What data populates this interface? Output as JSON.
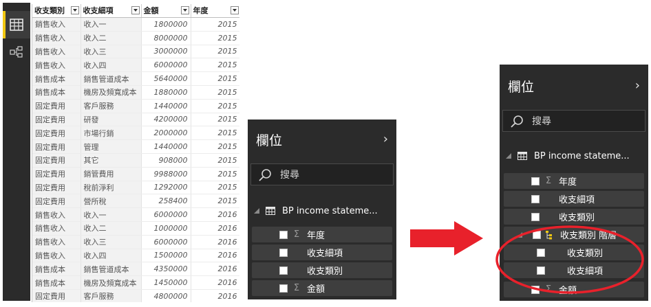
{
  "table": {
    "headers": [
      "收支類別",
      "收支細項",
      "金額",
      "年度"
    ],
    "rows": [
      [
        "銷售收入",
        "收入一",
        "1800000",
        "2015"
      ],
      [
        "銷售收入",
        "收入二",
        "8000000",
        "2015"
      ],
      [
        "銷售收入",
        "收入三",
        "3000000",
        "2015"
      ],
      [
        "銷售收入",
        "收入四",
        "6000000",
        "2015"
      ],
      [
        "銷售成本",
        "銷售管道成本",
        "5640000",
        "2015"
      ],
      [
        "銷售成本",
        "機房及頻寬成本",
        "1880000",
        "2015"
      ],
      [
        "固定費用",
        "客戶服務",
        "1440000",
        "2015"
      ],
      [
        "固定費用",
        "研發",
        "4200000",
        "2015"
      ],
      [
        "固定費用",
        "市場行銷",
        "2000000",
        "2015"
      ],
      [
        "固定費用",
        "管理",
        "1440000",
        "2015"
      ],
      [
        "固定費用",
        "其它",
        "908000",
        "2015"
      ],
      [
        "固定費用",
        "銷管費用",
        "9988000",
        "2015"
      ],
      [
        "固定費用",
        "稅前淨利",
        "1292000",
        "2015"
      ],
      [
        "固定費用",
        "營所稅",
        "258400",
        "2015"
      ],
      [
        "銷售收入",
        "收入一",
        "6000000",
        "2016"
      ],
      [
        "銷售收入",
        "收入二",
        "1000000",
        "2016"
      ],
      [
        "銷售收入",
        "收入三",
        "6000000",
        "2016"
      ],
      [
        "銷售收入",
        "收入四",
        "1500000",
        "2016"
      ],
      [
        "銷售成本",
        "銷售管道成本",
        "4350000",
        "2016"
      ],
      [
        "銷售成本",
        "機房及頻寬成本",
        "1450000",
        "2016"
      ],
      [
        "固定費用",
        "客戶服務",
        "4800000",
        "2016"
      ]
    ]
  },
  "rail": {
    "icons": [
      "table-view-icon",
      "model-view-icon"
    ]
  },
  "panel_before": {
    "title": "欄位",
    "search_placeholder": "搜尋",
    "table_name": "BP income stateme...",
    "fields": [
      {
        "label": "年度",
        "sigma": true
      },
      {
        "label": "收支細項",
        "sigma": false
      },
      {
        "label": "收支類別",
        "sigma": false
      },
      {
        "label": "金額",
        "sigma": true
      }
    ]
  },
  "panel_after": {
    "title": "欄位",
    "search_placeholder": "搜尋",
    "table_name": "BP income stateme...",
    "fields": [
      {
        "label": "年度",
        "sigma": true
      },
      {
        "label": "收支細項",
        "sigma": false
      },
      {
        "label": "收支類別",
        "sigma": false
      }
    ],
    "hierarchy": {
      "label": "收支類別 階層",
      "children": [
        "收支類別",
        "收支細項"
      ]
    },
    "last_field": {
      "label": "金額",
      "sigma": true
    },
    "sigma_glyph": "Σ"
  },
  "colors": {
    "panel_bg": "#2b2b2b",
    "field_row_bg": "#3e3e3e",
    "arrow_red": "#e8212b",
    "accent_yellow": "#f2c811"
  }
}
